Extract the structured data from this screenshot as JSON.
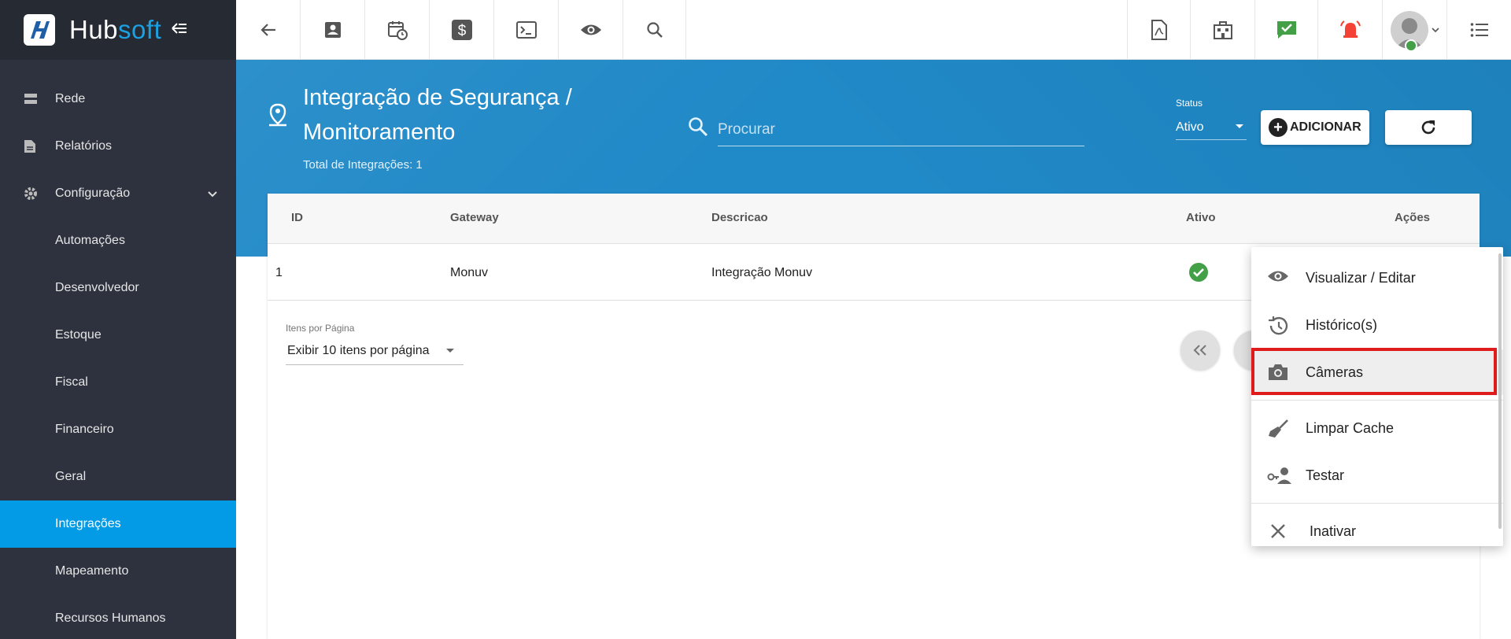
{
  "app": {
    "brand_part1": "Hub",
    "brand_part2": "soft"
  },
  "sidebar": {
    "items": [
      {
        "label": "Rede",
        "icon": "server-icon"
      },
      {
        "label": "Relatórios",
        "icon": "document-icon"
      },
      {
        "label": "Configuração",
        "icon": "gear-icon"
      },
      {
        "label": "Automações"
      },
      {
        "label": "Desenvolvedor"
      },
      {
        "label": "Estoque"
      },
      {
        "label": "Fiscal"
      },
      {
        "label": "Financeiro"
      },
      {
        "label": "Geral"
      },
      {
        "label": "Integrações",
        "active": true
      },
      {
        "label": "Mapeamento"
      },
      {
        "label": "Recursos Humanos"
      }
    ]
  },
  "header": {
    "title": "Integração de Segurança / Monitoramento",
    "subtitle": "Total de Integrações: 1",
    "search_placeholder": "Procurar",
    "status_label": "Status",
    "status_value": "Ativo",
    "add_label": "ADICIONAR"
  },
  "table": {
    "columns": [
      "ID",
      "Gateway",
      "Descricao",
      "Ativo",
      "Ações"
    ],
    "rows": [
      {
        "id": "1",
        "gateway": "Monuv",
        "descricao": "Integração Monuv",
        "ativo": true
      }
    ]
  },
  "pagination": {
    "items_label": "Itens por Página",
    "items_value": "Exibir 10 itens por página"
  },
  "menu": {
    "items": [
      {
        "label": "Visualizar / Editar",
        "icon": "eye-icon"
      },
      {
        "label": "Histórico(s)",
        "icon": "history-icon"
      },
      {
        "label": "Câmeras",
        "icon": "camera-icon",
        "highlighted": true
      },
      {
        "label": "Limpar Cache",
        "icon": "broom-icon"
      },
      {
        "label": "Testar",
        "icon": "key-person-icon"
      },
      {
        "label": "Inativar",
        "icon": "close-icon"
      }
    ]
  },
  "colors": {
    "sidebar_bg": "#2d323e",
    "sidebar_active": "#039be5",
    "header_blue": "#2089c7",
    "success_green": "#43a047",
    "alert_red": "#f44336",
    "highlight_border": "#e01b1b"
  }
}
